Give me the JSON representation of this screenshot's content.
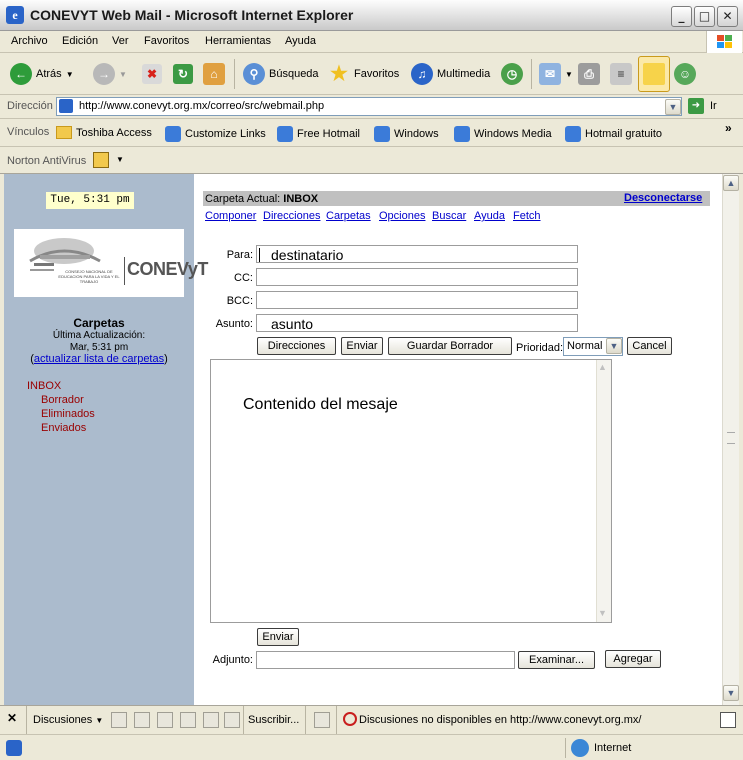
{
  "window": {
    "title": "CONEVYT Web Mail - Microsoft Internet Explorer"
  },
  "menu": [
    "Archivo",
    "Edición",
    "Ver",
    "Favoritos",
    "Herramientas",
    "Ayuda"
  ],
  "toolbar": {
    "back": "Atrás",
    "search": "Búsqueda",
    "favorites": "Favoritos",
    "multimedia": "Multimedia"
  },
  "address": {
    "label": "Dirección",
    "url": "http://www.conevyt.org.mx/correo/src/webmail.php",
    "go": "Ir"
  },
  "links": {
    "label": "Vínculos",
    "items": [
      "Toshiba Access",
      "Customize Links",
      "Free Hotmail",
      "Windows",
      "Windows Media",
      "Hotmail gratuito"
    ]
  },
  "norton": {
    "label": "Norton AntiVirus"
  },
  "sidebar": {
    "clock": "Tue, 5:31 pm",
    "logo_text": "CONEVyT",
    "logo_caption": "CONSEJO NACIONAL DE EDUCACION PARA LA VIDA Y EL TRABAJO",
    "folders_title": "Carpetas",
    "last_update_label": "Última Actualización:",
    "last_update_value": "Mar, 5:31 pm",
    "refresh_link": "actualizar lista de carpetas",
    "folders": [
      {
        "name": "INBOX",
        "level": 0
      },
      {
        "name": "Borrador",
        "level": 1
      },
      {
        "name": "Eliminados",
        "level": 1
      },
      {
        "name": "Enviados",
        "level": 1
      }
    ]
  },
  "header": {
    "current_folder_label": "Carpeta Actual:",
    "current_folder": "INBOX",
    "logout": "Desconectarse"
  },
  "nav": [
    "Componer",
    "Direcciones",
    "Carpetas",
    "Opciones",
    "Buscar",
    "Ayuda",
    "Fetch"
  ],
  "compose": {
    "to_label": "Para:",
    "to_value": "destinatario",
    "cc_label": "CC:",
    "cc_value": "",
    "bcc_label": "BCC:",
    "bcc_value": "",
    "subject_label": "Asunto:",
    "subject_value": "asunto",
    "btn_addresses": "Direcciones",
    "btn_send": "Enviar",
    "btn_save_draft": "Guardar Borrador",
    "priority_label": "Prioridad:",
    "priority_value": "Normal",
    "btn_cancel": "Cancel",
    "body_text": "Contenido del mesaje",
    "btn_send_bottom": "Enviar",
    "attach_label": "Adjunto:",
    "btn_browse": "Examinar...",
    "btn_add": "Agregar"
  },
  "discussions": {
    "label": "Discusiones",
    "subscribe": "Suscribir...",
    "message": "Discusiones no disponibles en http://www.conevyt.org.mx/"
  },
  "status": {
    "zone": "Internet"
  },
  "colors": {
    "sidebar": "#abbbcd",
    "header_bar": "#c0c0c0",
    "link": "#0000cc",
    "folder": "#990000",
    "clock_bg": "#ffffcc"
  }
}
